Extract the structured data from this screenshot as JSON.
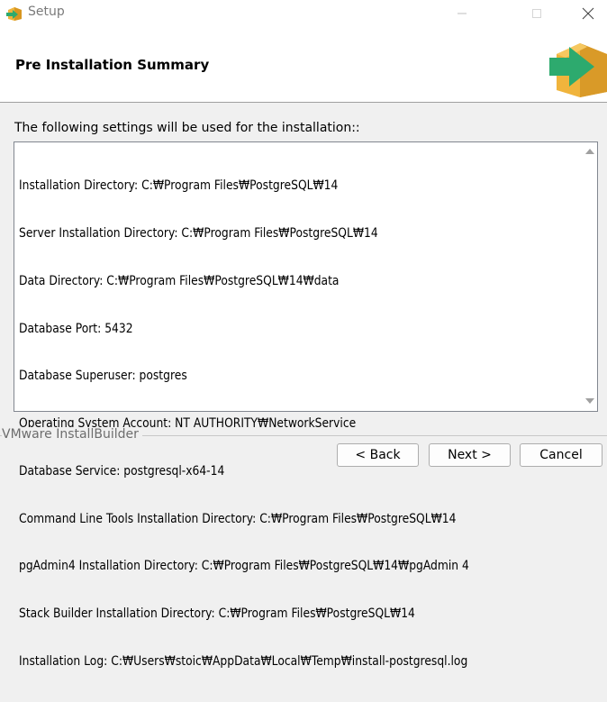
{
  "window": {
    "title": "Setup",
    "icon": "installer-box-icon"
  },
  "header": {
    "title": "Pre Installation Summary",
    "logo": "installer-arrow-box-icon",
    "colors": {
      "box": "#f0b43c",
      "arrow": "#2daa6e"
    }
  },
  "main": {
    "intro": "The following settings will be used for the installation::",
    "summary_lines": [
      "Installation Directory: C:₩Program Files₩PostgreSQL₩14",
      "Server Installation Directory: C:₩Program Files₩PostgreSQL₩14",
      "Data Directory: C:₩Program Files₩PostgreSQL₩14₩data",
      "Database Port: 5432",
      "Database Superuser: postgres",
      "Operating System Account: NT AUTHORITY₩NetworkService",
      "Database Service: postgresql-x64-14",
      "Command Line Tools Installation Directory: C:₩Program Files₩PostgreSQL₩14",
      "pgAdmin4 Installation Directory: C:₩Program Files₩PostgreSQL₩14₩pgAdmin 4",
      "Stack Builder Installation Directory: C:₩Program Files₩PostgreSQL₩14",
      "Installation Log: C:₩Users₩stoic₩AppData₩Local₩Temp₩install-postgresql.log"
    ]
  },
  "footer": {
    "brand": "VMware InstallBuilder",
    "back_label": "< Back",
    "next_label": "Next >",
    "cancel_label": "Cancel"
  }
}
